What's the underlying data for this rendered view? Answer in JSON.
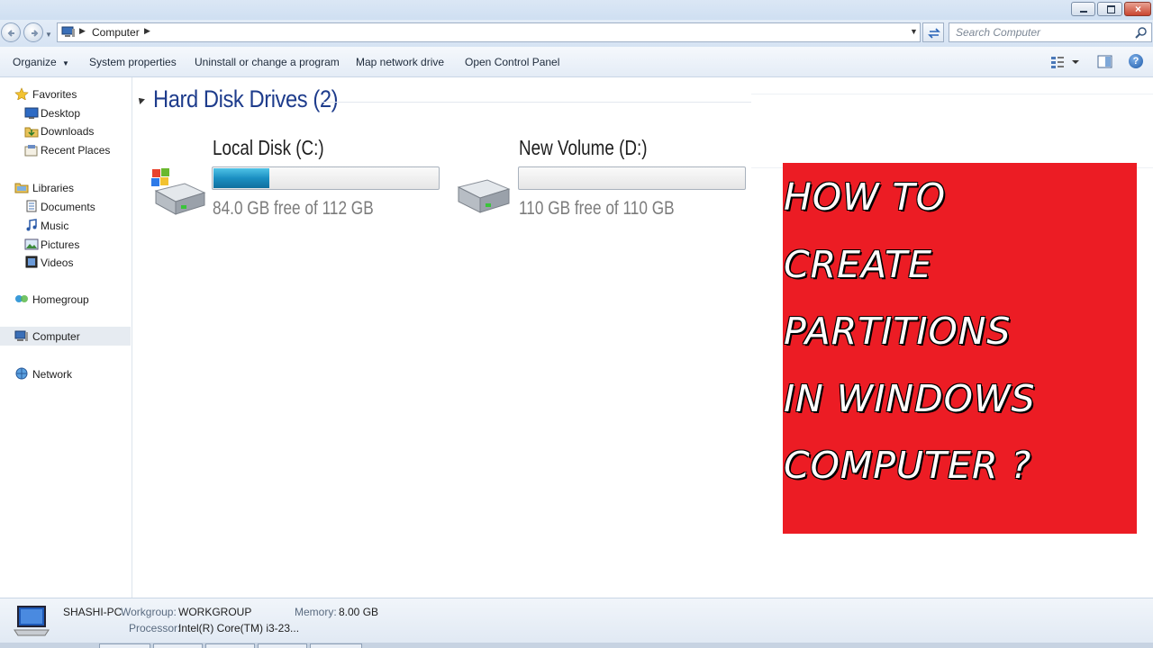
{
  "window": {
    "controls": {
      "minimize": "minimize-icon",
      "maximize": "restore-icon",
      "close": "close-icon"
    }
  },
  "address": {
    "path": [
      "Computer"
    ],
    "search_placeholder": "Search Computer"
  },
  "toolbar": {
    "items": [
      "Organize",
      "System properties",
      "Uninstall or change a program",
      "Map network drive",
      "Open Control Panel"
    ]
  },
  "sidebar": {
    "favorites": {
      "label": "Favorites",
      "items": [
        "Desktop",
        "Downloads",
        "Recent Places"
      ]
    },
    "libraries": {
      "label": "Libraries",
      "items": [
        "Documents",
        "Music",
        "Pictures",
        "Videos"
      ]
    },
    "homegroup": "Homegroup",
    "computer": "Computer",
    "network": "Network"
  },
  "content": {
    "group_title": "Hard Disk Drives (2)",
    "drives": [
      {
        "name": "Local Disk (C:)",
        "free_text": "84.0 GB free of 112 GB",
        "used_fraction": 0.25,
        "icon": "windows-drive-icon"
      },
      {
        "name": "New Volume (D:)",
        "free_text": "110 GB free of 110 GB",
        "used_fraction": 0.0,
        "icon": "drive-icon"
      }
    ]
  },
  "overlay": {
    "background": "#ec1c24",
    "lines": [
      "HOW TO",
      "CREATE",
      "PARTITIONS",
      "IN WINDOWS",
      "COMPUTER ?"
    ]
  },
  "details": {
    "computer_name": "SHASHI-PC",
    "workgroup_label": "Workgroup:",
    "workgroup": "WORKGROUP",
    "memory_label": "Memory:",
    "memory": "8.00 GB",
    "processor_label": "Processor:",
    "processor": "Intel(R) Core(TM) i3-23..."
  }
}
